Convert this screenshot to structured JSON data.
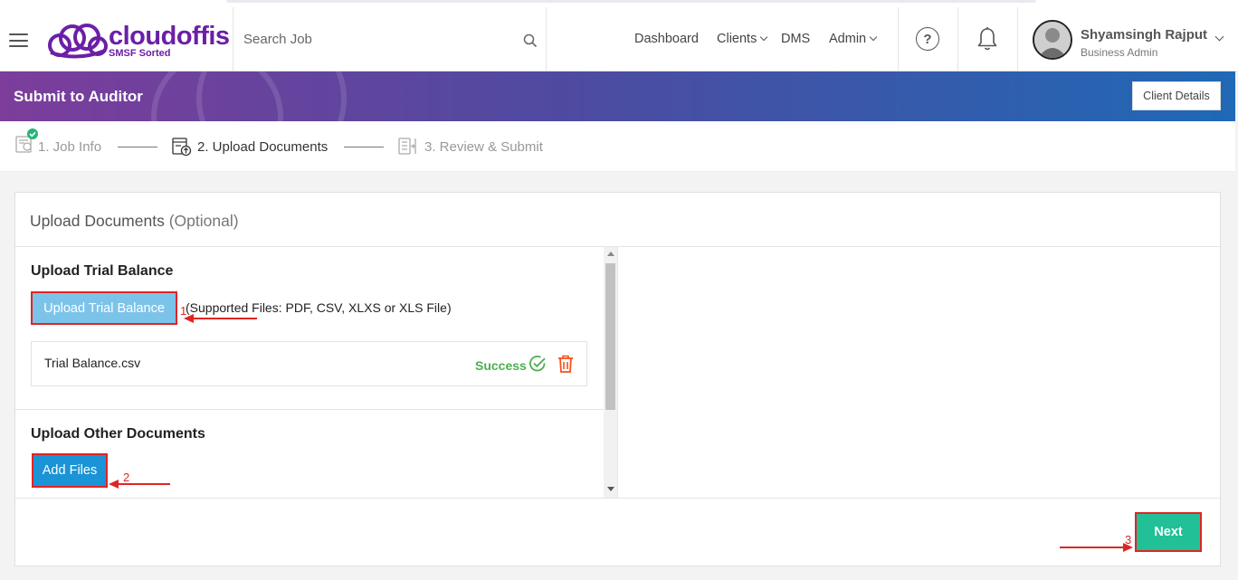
{
  "header": {
    "logo_text": "cloudoffis",
    "logo_subtitle": "SMSF Sorted",
    "search_placeholder": "Search Job",
    "nav": [
      {
        "label": "Dashboard"
      },
      {
        "label": "Clients"
      },
      {
        "label": "DMS"
      },
      {
        "label": "Admin"
      }
    ],
    "help_icon_label": "?",
    "user": {
      "name": "Shyamsingh Rajput",
      "role": "Business Admin"
    }
  },
  "banner": {
    "title": "Submit to Auditor",
    "client_details_label": "Client Details"
  },
  "stepper": {
    "steps": [
      {
        "label": "1. Job Info",
        "state": "done"
      },
      {
        "label": "2. Upload Documents",
        "state": "active"
      },
      {
        "label": "3. Review & Submit",
        "state": "todo"
      }
    ]
  },
  "upload": {
    "title": "Upload Documents",
    "title_suffix": "(Optional)",
    "trial_balance": {
      "heading": "Upload Trial Balance",
      "button_label": "Upload Trial Balance",
      "supported_text": "(Supported Files: PDF, CSV, XLXS or XLS File)",
      "file": {
        "name": "Trial Balance.csv",
        "status": "Success"
      }
    },
    "other_documents": {
      "heading": "Upload Other Documents",
      "button_label": "Add Files"
    },
    "next_label": "Next"
  },
  "annotations": [
    {
      "number": "1"
    },
    {
      "number": "2"
    },
    {
      "number": "3"
    }
  ],
  "colors": {
    "brand_purple": "#6b1fa8",
    "banner_start": "#7c3d9b",
    "banner_end": "#1f69b6",
    "success_green": "#4caf50",
    "next_button": "#21c097",
    "add_files_button": "#1a94d6",
    "trial_button": "#7cc3ea",
    "annotation_red": "#e02424",
    "delete_orange": "#f4511e"
  }
}
